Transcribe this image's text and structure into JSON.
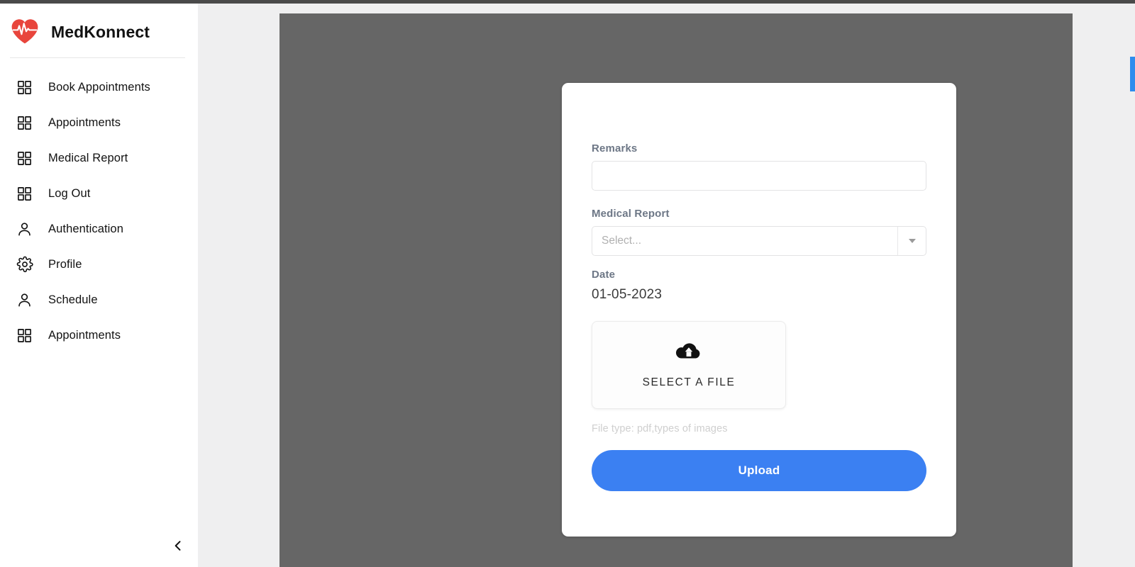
{
  "brand": {
    "name": "MedKonnect",
    "logo_icon": "heart-pulse-icon",
    "logo_color": "#e8453c"
  },
  "sidebar": {
    "collapse_icon": "chevron-left-icon",
    "items": [
      {
        "label": "Book Appointments",
        "icon": "grid-icon"
      },
      {
        "label": "Appointments",
        "icon": "grid-icon"
      },
      {
        "label": "Medical Report",
        "icon": "grid-icon"
      },
      {
        "label": "Log Out",
        "icon": "grid-icon"
      },
      {
        "label": "Authentication",
        "icon": "person-icon"
      },
      {
        "label": "Profile",
        "icon": "gear-icon"
      },
      {
        "label": "Schedule",
        "icon": "person-icon"
      },
      {
        "label": "Appointments",
        "icon": "grid-icon"
      }
    ]
  },
  "form": {
    "remarks": {
      "label": "Remarks",
      "value": "",
      "placeholder": ""
    },
    "medical_report": {
      "label": "Medical Report",
      "selected": "Select...",
      "dropdown_icon": "caret-down-icon"
    },
    "date": {
      "label": "Date",
      "value": "01-05-2023"
    },
    "dropzone": {
      "label": "SELECT A FILE",
      "icon": "cloud-upload-icon"
    },
    "file_type_hint": "File type: pdf,types of images",
    "submit": {
      "label": "Upload",
      "color": "#3b80f2"
    }
  },
  "colors": {
    "accent_blue": "#3b80f2",
    "overlay_gray": "#666666",
    "page_bg": "#efeff0",
    "label_gray": "#6d7786"
  }
}
